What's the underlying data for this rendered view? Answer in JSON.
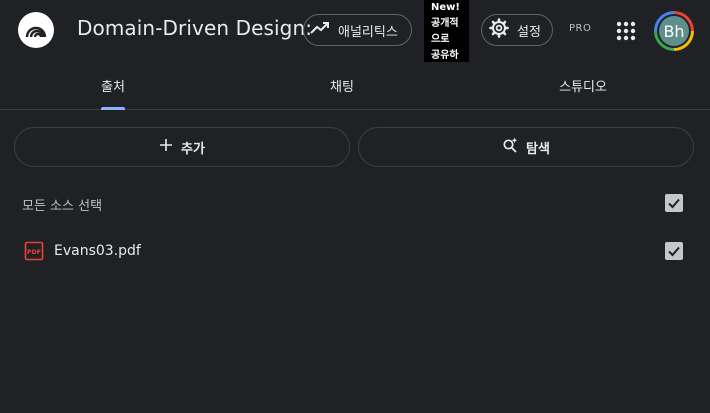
{
  "header": {
    "logo_icon": "notebooklm-logo-icon",
    "title": "Domain-Driven Design:",
    "analytics_label": "애널리틱스",
    "analytics_icon": "trending-up-icon",
    "new_badge": [
      "New!",
      "공개적",
      "으로",
      "공유하"
    ],
    "settings_label": "설정",
    "settings_icon": "gear-icon",
    "pro_label": "PRO",
    "apps_icon": "apps-grid-icon",
    "avatar_initials": "Bh"
  },
  "tabs": [
    {
      "label": "출처",
      "active": true
    },
    {
      "label": "채팅",
      "active": false
    },
    {
      "label": "스튜디오",
      "active": false
    }
  ],
  "actions": {
    "add_label": "추가",
    "add_icon": "plus-icon",
    "explore_label": "탐색",
    "explore_icon": "search-sparkle-icon"
  },
  "sources": {
    "select_all_label": "모든 소스 선택",
    "select_all_checked": true,
    "items": [
      {
        "name": "Evans03.pdf",
        "icon": "pdf-icon",
        "checked": true
      }
    ]
  },
  "colors": {
    "background": "#202124",
    "accent": "#8ab4f8",
    "pdf_red": "#e94235"
  }
}
